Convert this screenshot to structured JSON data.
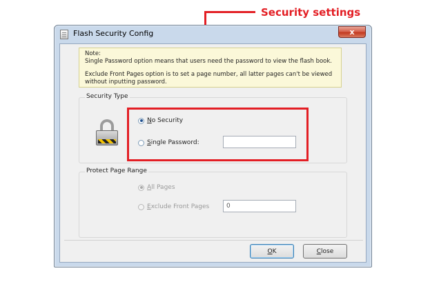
{
  "annotation": {
    "label": "Security settings",
    "color": "#e31e24"
  },
  "window": {
    "title": "Flash Security Config",
    "close_glyph": "x"
  },
  "note": {
    "heading": "Note:",
    "line1": "Single Password option means that users need the password to view the flash book.",
    "line2": "Exclude Front Pages option is to set a page number, all latter pages can't be viewed without inputting password."
  },
  "security_type": {
    "label": "Security Type",
    "no_security": {
      "accel": "N",
      "rest": "o Security",
      "checked": true
    },
    "single_password": {
      "accel": "S",
      "rest": "ingle Password:",
      "checked": false,
      "value": ""
    }
  },
  "protect_range": {
    "label": "Protect Page Range",
    "all_pages": {
      "accel": "A",
      "rest": "ll Pages",
      "checked": true,
      "enabled": false
    },
    "exclude_front": {
      "accel": "E",
      "rest": "xclude Front Pages",
      "checked": false,
      "enabled": false,
      "value": "0"
    }
  },
  "buttons": {
    "ok": {
      "accel": "O",
      "rest": "K"
    },
    "close": {
      "accel": "C",
      "rest": "lose"
    }
  }
}
